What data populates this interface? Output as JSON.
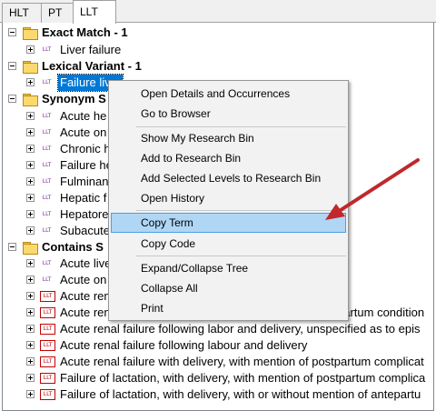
{
  "tabs": [
    "HLT",
    "PT",
    "LLT"
  ],
  "tree": {
    "exact_match": {
      "label": "Exact Match - 1",
      "children": [
        "Liver failure"
      ]
    },
    "lexical_variant": {
      "label": "Lexical Variant - 1",
      "children": [
        "Failure liver"
      ]
    },
    "synonym": {
      "label": "Synonym S",
      "children": [
        "Acute he",
        "Acute on",
        "Chronic h",
        "Failure he",
        "Fulminan",
        "Hepatic f",
        "Hepatore",
        "Subacute"
      ]
    },
    "contains": {
      "label": "Contains S",
      "children": [
        "Acute live",
        "Acute on",
        "Acute ren",
        "Acute ren",
        "Acute renal failure following labor and delivery, unspecified as to epis",
        "Acute renal failure following labour and delivery",
        "Acute renal failure with delivery, with mention of postpartum complicat",
        "Failure of lactation, with delivery, with mention of postpartum complica",
        "Failure of lactation, with delivery, with or without mention of antepartu"
      ],
      "row4_tail": "partum condition"
    }
  },
  "icon_text": "LLT",
  "context_menu": {
    "items": [
      "Open Details and Occurrences",
      "Go to Browser",
      "Show My Research Bin",
      "Add to Research Bin",
      "Add Selected Levels to Research Bin",
      "Open History",
      "Copy Term",
      "Copy Code",
      "Expand/Collapse Tree",
      "Collapse All",
      "Print"
    ]
  },
  "colors": {
    "selection": "#0078d7",
    "menu_hover": "#b0d6f5",
    "arrow": "#c0282c"
  }
}
